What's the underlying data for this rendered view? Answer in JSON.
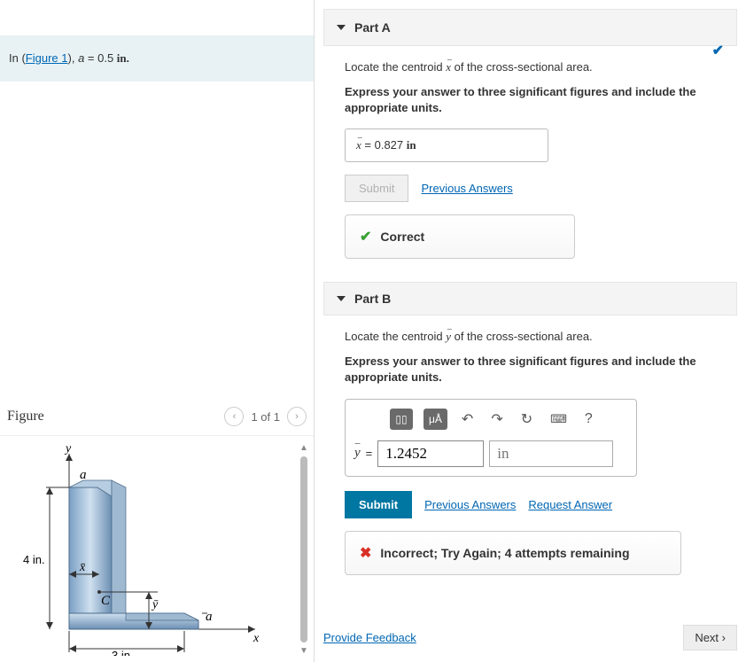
{
  "problem": {
    "intro_prefix": "In (",
    "figure_link": "Figure 1",
    "intro_after_link": "), ",
    "var_a": "a",
    "equals": " = 0.5 ",
    "unit": "in."
  },
  "figure": {
    "title": "Figure",
    "pager": "1 of 1",
    "labels": {
      "y_axis": "y",
      "x_axis": "x",
      "a_top": "a",
      "a_right": "a",
      "four_in": "4 in.",
      "three_in": "3 in.",
      "xbar": "x̄",
      "ybar": "ȳ",
      "c": "C"
    }
  },
  "partA": {
    "title": "Part A",
    "prompt": "Locate the centroid x̄ of the cross-sectional area.",
    "hint": "Express your answer to three significant figures and include the appropriate units.",
    "answer_label": "x̄ = ",
    "answer_value": "0.827 ",
    "answer_unit": "in",
    "submit": "Submit",
    "prev": "Previous Answers",
    "correct": "Correct"
  },
  "partB": {
    "title": "Part B",
    "prompt": "Locate the centroid ȳ of the cross-sectional area.",
    "hint": "Express your answer to three significant figures and include the appropriate units.",
    "ylabel": "ȳ",
    "eq": " = ",
    "value": "1.2452",
    "unit": "in",
    "submit": "Submit",
    "prev": "Previous Answers",
    "request": "Request Answer",
    "incorrect": "Incorrect; Try Again; 4 attempts remaining",
    "toolbar": {
      "templates": "▯▯",
      "special": "μÅ",
      "undo": "↶",
      "redo": "↷",
      "reset": "↻",
      "keyboard": "⌨",
      "help": "?"
    }
  },
  "footer": {
    "feedback": "Provide Feedback",
    "next": "Next "
  }
}
